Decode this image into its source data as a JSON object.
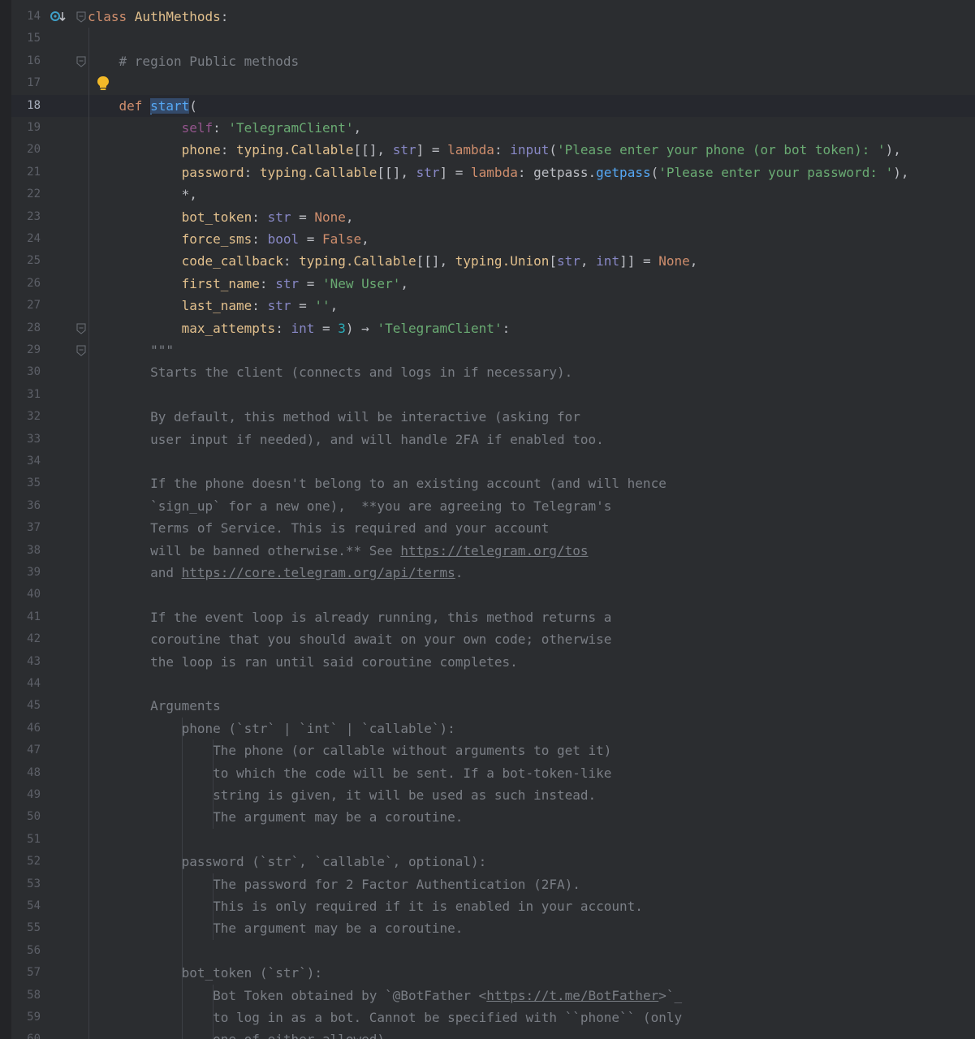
{
  "editor": {
    "current_line": 18,
    "lines": [
      {
        "n": "14",
        "segs": [
          [
            "k",
            "class "
          ],
          [
            "cls",
            "AuthMethods"
          ],
          [
            "",
            ""
          ],
          [
            "",
            ":"
          ]
        ]
      },
      {
        "n": "15",
        "segs": []
      },
      {
        "n": "16",
        "segs": [
          [
            "",
            "    "
          ],
          [
            "cmt",
            "# region Public methods"
          ]
        ]
      },
      {
        "n": "17",
        "segs": []
      },
      {
        "n": "18",
        "segs": [
          [
            "",
            "    "
          ],
          [
            "k",
            "def "
          ],
          [
            "caret",
            ""
          ],
          [
            "fn hl",
            "start"
          ],
          [
            "",
            "("
          ]
        ]
      },
      {
        "n": "19",
        "segs": [
          [
            "",
            "            "
          ],
          [
            "self",
            "self"
          ],
          [
            "",
            ": "
          ],
          [
            "str",
            "'TelegramClient'"
          ],
          [
            "",
            ","
          ]
        ]
      },
      {
        "n": "20",
        "segs": [
          [
            "",
            "            "
          ],
          [
            "cls",
            "phone"
          ],
          [
            "",
            ": "
          ],
          [
            "cls",
            "typing.Callable"
          ],
          [
            "",
            "[[], "
          ],
          [
            "builtin",
            "str"
          ],
          [
            "",
            "] = "
          ],
          [
            "k",
            "lambda"
          ],
          [
            "",
            ": "
          ],
          [
            "builtin",
            "input"
          ],
          [
            "",
            "("
          ],
          [
            "str",
            "'Please enter your phone (or bot token): '"
          ],
          [
            "",
            "),"
          ]
        ]
      },
      {
        "n": "21",
        "segs": [
          [
            "",
            "            "
          ],
          [
            "cls",
            "password"
          ],
          [
            "",
            ": "
          ],
          [
            "cls",
            "typing.Callable"
          ],
          [
            "",
            "[[], "
          ],
          [
            "builtin",
            "str"
          ],
          [
            "",
            "] = "
          ],
          [
            "k",
            "lambda"
          ],
          [
            "",
            ": getpass."
          ],
          [
            "fn",
            "getpass"
          ],
          [
            "",
            "("
          ],
          [
            "str",
            "'Please enter your password: '"
          ],
          [
            "",
            "),"
          ]
        ]
      },
      {
        "n": "22",
        "segs": [
          [
            "",
            "            *,"
          ]
        ]
      },
      {
        "n": "23",
        "segs": [
          [
            "",
            "            "
          ],
          [
            "cls",
            "bot_token"
          ],
          [
            "",
            ": "
          ],
          [
            "builtin",
            "str"
          ],
          [
            "",
            " = "
          ],
          [
            "k",
            "None"
          ],
          [
            "",
            ","
          ]
        ]
      },
      {
        "n": "24",
        "segs": [
          [
            "",
            "            "
          ],
          [
            "cls",
            "force_sms"
          ],
          [
            "",
            ": "
          ],
          [
            "builtin",
            "bool"
          ],
          [
            "",
            " = "
          ],
          [
            "k",
            "False"
          ],
          [
            "",
            ","
          ]
        ]
      },
      {
        "n": "25",
        "segs": [
          [
            "",
            "            "
          ],
          [
            "cls",
            "code_callback"
          ],
          [
            "",
            ": "
          ],
          [
            "cls",
            "typing.Callable"
          ],
          [
            "",
            "[[], "
          ],
          [
            "cls",
            "typing.Union"
          ],
          [
            "",
            "["
          ],
          [
            "builtin",
            "str"
          ],
          [
            "",
            ", "
          ],
          [
            "builtin",
            "int"
          ],
          [
            "",
            "]] = "
          ],
          [
            "k",
            "None"
          ],
          [
            "",
            ","
          ]
        ]
      },
      {
        "n": "26",
        "segs": [
          [
            "",
            "            "
          ],
          [
            "cls",
            "first_name"
          ],
          [
            "",
            ": "
          ],
          [
            "builtin",
            "str"
          ],
          [
            "",
            " = "
          ],
          [
            "str",
            "'New User'"
          ],
          [
            "",
            ","
          ]
        ]
      },
      {
        "n": "27",
        "segs": [
          [
            "",
            "            "
          ],
          [
            "cls",
            "last_name"
          ],
          [
            "",
            ": "
          ],
          [
            "builtin",
            "str"
          ],
          [
            "",
            " = "
          ],
          [
            "str",
            "''"
          ],
          [
            "",
            ","
          ]
        ]
      },
      {
        "n": "28",
        "segs": [
          [
            "",
            "            "
          ],
          [
            "cls",
            "max_attempts"
          ],
          [
            "",
            ": "
          ],
          [
            "builtin",
            "int"
          ],
          [
            "",
            " = "
          ],
          [
            "num",
            "3"
          ],
          [
            "",
            ") → "
          ],
          [
            "str",
            "'TelegramClient'"
          ],
          [
            "",
            ":"
          ]
        ]
      },
      {
        "n": "29",
        "segs": [
          [
            "",
            "        "
          ],
          [
            "doc",
            "\"\"\""
          ]
        ]
      },
      {
        "n": "30",
        "segs": [
          [
            "",
            "        "
          ],
          [
            "doc",
            "Starts the client (connects and logs in if necessary)."
          ]
        ]
      },
      {
        "n": "31",
        "segs": []
      },
      {
        "n": "32",
        "segs": [
          [
            "",
            "        "
          ],
          [
            "doc",
            "By default, this method will be interactive (asking for"
          ]
        ]
      },
      {
        "n": "33",
        "segs": [
          [
            "",
            "        "
          ],
          [
            "doc",
            "user input if needed), and will handle 2FA if enabled too."
          ]
        ]
      },
      {
        "n": "34",
        "segs": []
      },
      {
        "n": "35",
        "segs": [
          [
            "",
            "        "
          ],
          [
            "doc",
            "If the phone doesn't belong to an existing account (and will hence"
          ]
        ]
      },
      {
        "n": "36",
        "segs": [
          [
            "",
            "        "
          ],
          [
            "doc",
            "`sign_up` for a new one),  **you are agreeing to Telegram's"
          ]
        ]
      },
      {
        "n": "37",
        "segs": [
          [
            "",
            "        "
          ],
          [
            "doc",
            "Terms of Service. This is required and your account"
          ]
        ]
      },
      {
        "n": "38",
        "segs": [
          [
            "",
            "        "
          ],
          [
            "doc",
            "will be banned otherwise.** See "
          ],
          [
            "lnk",
            "https://telegram.org/tos"
          ]
        ]
      },
      {
        "n": "39",
        "segs": [
          [
            "",
            "        "
          ],
          [
            "doc",
            "and "
          ],
          [
            "lnk",
            "https://core.telegram.org/api/terms"
          ],
          [
            "doc",
            "."
          ]
        ]
      },
      {
        "n": "40",
        "segs": []
      },
      {
        "n": "41",
        "segs": [
          [
            "",
            "        "
          ],
          [
            "doc",
            "If the event loop is already running, this method returns a"
          ]
        ]
      },
      {
        "n": "42",
        "segs": [
          [
            "",
            "        "
          ],
          [
            "doc",
            "coroutine that you should await on your own code; otherwise"
          ]
        ]
      },
      {
        "n": "43",
        "segs": [
          [
            "",
            "        "
          ],
          [
            "doc",
            "the loop is ran until said coroutine completes."
          ]
        ]
      },
      {
        "n": "44",
        "segs": []
      },
      {
        "n": "45",
        "segs": [
          [
            "",
            "        "
          ],
          [
            "doc",
            "Arguments"
          ]
        ]
      },
      {
        "n": "46",
        "segs": [
          [
            "",
            "            "
          ],
          [
            "doc",
            "phone (`str` | `int` | `callable`):"
          ]
        ]
      },
      {
        "n": "47",
        "segs": [
          [
            "",
            "                "
          ],
          [
            "doc",
            "The phone (or callable without arguments to get it)"
          ]
        ]
      },
      {
        "n": "48",
        "segs": [
          [
            "",
            "                "
          ],
          [
            "doc",
            "to which the code will be sent. If a bot-token-like"
          ]
        ]
      },
      {
        "n": "49",
        "segs": [
          [
            "",
            "                "
          ],
          [
            "doc",
            "string is given, it will be used as such instead."
          ]
        ]
      },
      {
        "n": "50",
        "segs": [
          [
            "",
            "                "
          ],
          [
            "doc",
            "The argument may be a coroutine."
          ]
        ]
      },
      {
        "n": "51",
        "segs": []
      },
      {
        "n": "52",
        "segs": [
          [
            "",
            "            "
          ],
          [
            "doc",
            "password (`str`, `callable`, optional):"
          ]
        ]
      },
      {
        "n": "53",
        "segs": [
          [
            "",
            "                "
          ],
          [
            "doc",
            "The password for 2 Factor Authentication (2FA)."
          ]
        ]
      },
      {
        "n": "54",
        "segs": [
          [
            "",
            "                "
          ],
          [
            "doc",
            "This is only required if it is enabled in your account."
          ]
        ]
      },
      {
        "n": "55",
        "segs": [
          [
            "",
            "                "
          ],
          [
            "doc",
            "The argument may be a coroutine."
          ]
        ]
      },
      {
        "n": "56",
        "segs": []
      },
      {
        "n": "57",
        "segs": [
          [
            "",
            "            "
          ],
          [
            "doc",
            "bot_token (`str`):"
          ]
        ]
      },
      {
        "n": "58",
        "segs": [
          [
            "",
            "                "
          ],
          [
            "doc",
            "Bot Token obtained by `@BotFather <"
          ],
          [
            "lnk",
            "https://t.me/BotFather"
          ],
          [
            "doc",
            ">`_"
          ]
        ]
      },
      {
        "n": "59",
        "segs": [
          [
            "",
            "                "
          ],
          [
            "doc",
            "to log in as a bot. Cannot be specified with ``phone`` (only"
          ]
        ]
      },
      {
        "n": "60",
        "segs": [
          [
            "",
            "                "
          ],
          [
            "doc",
            "one of either allowed)."
          ]
        ]
      }
    ]
  },
  "icons": {
    "implements": "override-down-icon",
    "fold": "fold-marker-icon",
    "intention": "lightbulb-icon"
  },
  "colors": {
    "background": "#2b2d30",
    "keyword": "#cf8e6d",
    "string": "#6aab73",
    "function": "#56a8f5",
    "docstring": "#7a7e85"
  }
}
